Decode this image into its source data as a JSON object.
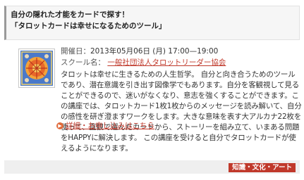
{
  "event": {
    "title_line1": "自分の隠れた才能をカードで探す！",
    "title_line2": "「タロットカードは幸せになるためのツール」",
    "date_label": "開催日：",
    "date_value": "2013年05月06日 (月) 17:00—19:00",
    "school_label": "スクール名：",
    "school_name": "一般社団法人タロットリーダー協会",
    "description": "タロットは幸せに生きるための人生哲学。 自分と向き合うためのツールであり、潜在意識を引き出す図像学でもあります。自分を客観視して見ることができるので、迷いがなくなり、意志を強くすることができます。この講座では、タロットカード1枚1枚からのメッセージを読み解いて、自分の感性を研ぎ澄ますワークをします。大きな意味を表す大アルカナ22枚を使って、直観で選んだカードから、ストーリーを組み立て、いまある問題をHAPPYに解決します。 この講座を受けると自分でタロットカードが使えるようになります。",
    "detail_link": "詳細・お申し込みはこちら",
    "category": "知識・文化・アート"
  },
  "icons": {
    "thumbnail": "tarot-card-thumbnail",
    "link_arrow": "circle-arrow-icon"
  },
  "colors": {
    "link": "#c0392b",
    "category_bg": "#c0392b",
    "arrow": "#e06a3b"
  }
}
